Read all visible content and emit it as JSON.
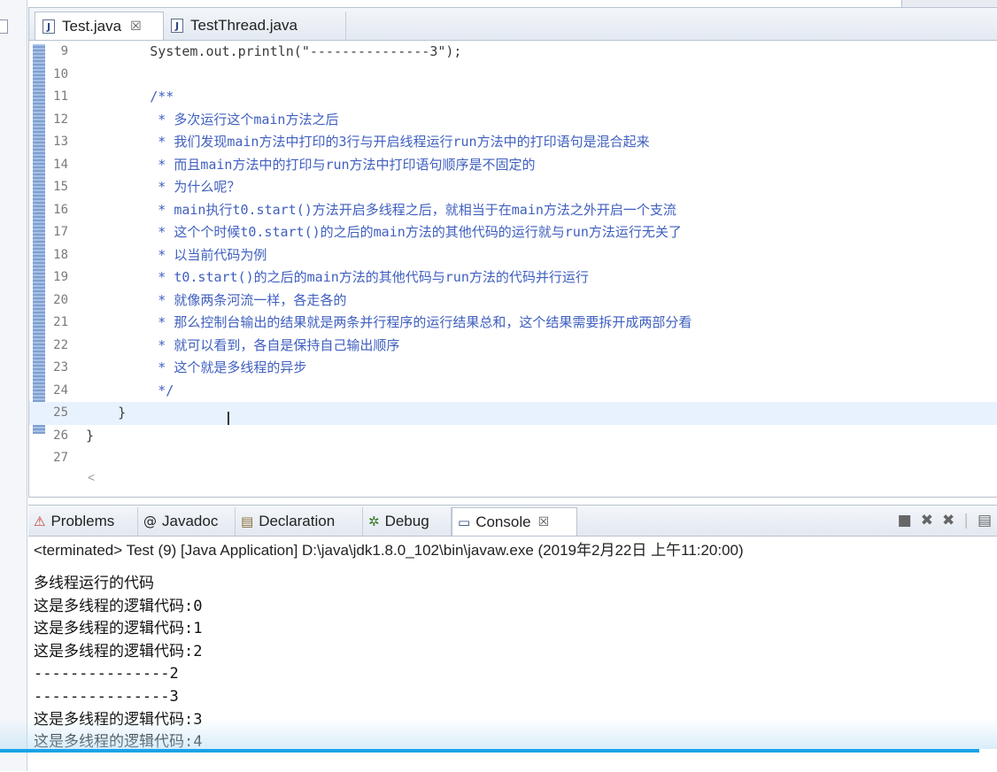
{
  "editor": {
    "tabs": [
      {
        "label": "Test.java",
        "active": true,
        "close": "☒"
      },
      {
        "label": "TestThread.java",
        "active": false
      }
    ],
    "lines": [
      {
        "num": "9",
        "text": "        System.out.println(\"---------------3\");",
        "kind": "code"
      },
      {
        "num": "10",
        "text": "",
        "kind": "code"
      },
      {
        "num": "11",
        "text": "        /**",
        "kind": "comment"
      },
      {
        "num": "12",
        "text": "         * 多次运行这个main方法之后",
        "kind": "comment"
      },
      {
        "num": "13",
        "text": "         * 我们发现main方法中打印的3行与开启线程运行run方法中的打印语句是混合起来",
        "kind": "comment"
      },
      {
        "num": "14",
        "text": "         * 而且main方法中的打印与run方法中打印语句顺序是不固定的",
        "kind": "comment"
      },
      {
        "num": "15",
        "text": "         * 为什么呢？",
        "kind": "comment"
      },
      {
        "num": "16",
        "text": "         * main执行t0.start()方法开启多线程之后，就相当于在main方法之外开启一个支流",
        "kind": "comment"
      },
      {
        "num": "17",
        "text": "         * 这个个时候t0.start()的之后的main方法的其他代码的运行就与run方法运行无关了",
        "kind": "comment"
      },
      {
        "num": "18",
        "text": "         * 以当前代码为例",
        "kind": "comment"
      },
      {
        "num": "19",
        "text": "         * t0.start()的之后的main方法的其他代码与run方法的代码并行运行",
        "kind": "comment"
      },
      {
        "num": "20",
        "text": "         * 就像两条河流一样，各走各的",
        "kind": "comment"
      },
      {
        "num": "21",
        "text": "         * 那么控制台输出的结果就是两条并行程序的运行结果总和，这个结果需要拆开成两部分看",
        "kind": "comment"
      },
      {
        "num": "22",
        "text": "         * 就可以看到，各自是保持自己输出顺序",
        "kind": "comment"
      },
      {
        "num": "23",
        "text": "         * 这个就是多线程的异步",
        "kind": "comment"
      },
      {
        "num": "24",
        "text": "         */",
        "kind": "comment"
      },
      {
        "num": "25",
        "text": "    }",
        "kind": "current"
      },
      {
        "num": "26",
        "text": "}",
        "kind": "code"
      },
      {
        "num": "27",
        "text": "",
        "kind": "code"
      }
    ],
    "scroll_arrow": "<"
  },
  "console": {
    "tabs": [
      {
        "label": "Problems",
        "icon": "problems-icon",
        "glyph": "⚠"
      },
      {
        "label": "Javadoc",
        "icon": "javadoc-icon",
        "glyph": "@"
      },
      {
        "label": "Declaration",
        "icon": "declaration-icon",
        "glyph": "▤"
      },
      {
        "label": "Debug",
        "icon": "debug-icon",
        "glyph": "✲"
      },
      {
        "label": "Console",
        "icon": "console-icon",
        "glyph": "▭",
        "active": true,
        "close": "☒"
      }
    ],
    "status": "<terminated> Test (9) [Java Application] D:\\java\\jdk1.8.0_102\\bin\\javaw.exe (2019年2月22日 上午11:20:00)",
    "output": [
      "多线程运行的代码",
      "这是多线程的逻辑代码:0",
      "这是多线程的逻辑代码:1",
      "这是多线程的逻辑代码:2",
      "---------------2",
      "---------------3",
      "这是多线程的逻辑代码:3",
      "这是多线程的逻辑代码:4"
    ]
  }
}
